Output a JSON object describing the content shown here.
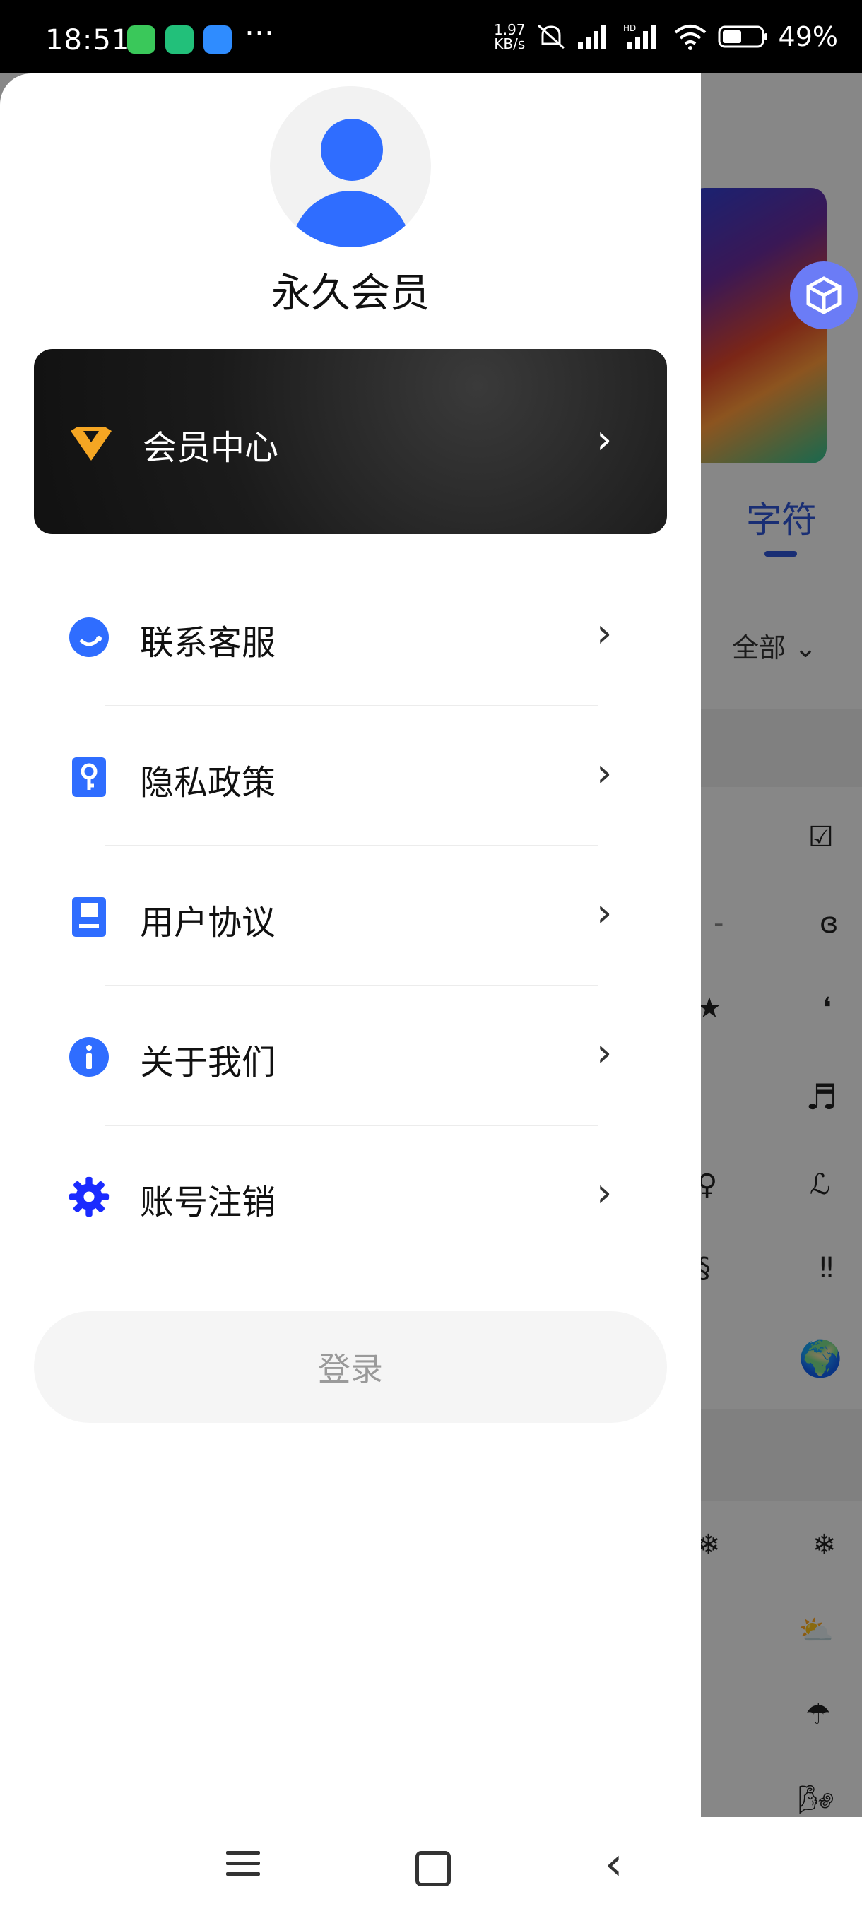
{
  "status_bar": {
    "time": "18:51",
    "net_speed_value": "1.97",
    "net_speed_unit": "KB/s",
    "battery": "49%",
    "more": "···"
  },
  "background": {
    "tab_label": "字符",
    "filter_label": "全部",
    "symbols": [
      "☑",
      "-",
      "ɞ",
      "★",
      "❛",
      "♬",
      "♀",
      "ℒ",
      "§",
      "‼",
      "🌍",
      "❄",
      "❄",
      "⛅",
      "☂",
      "🌬"
    ]
  },
  "drawer": {
    "username": "永久会员",
    "vip_card": {
      "label": "会员中心",
      "accent": "#f5a623"
    },
    "menu": [
      {
        "label": "联系客服",
        "icon": "customer-service-icon"
      },
      {
        "label": "隐私政策",
        "icon": "privacy-key-icon"
      },
      {
        "label": "用户协议",
        "icon": "agreement-doc-icon"
      },
      {
        "label": "关于我们",
        "icon": "info-icon"
      },
      {
        "label": "账号注销",
        "icon": "gear-icon"
      }
    ],
    "login_label": "登录"
  },
  "colors": {
    "accent": "#2f6dff",
    "gear": "#1a2bff"
  }
}
